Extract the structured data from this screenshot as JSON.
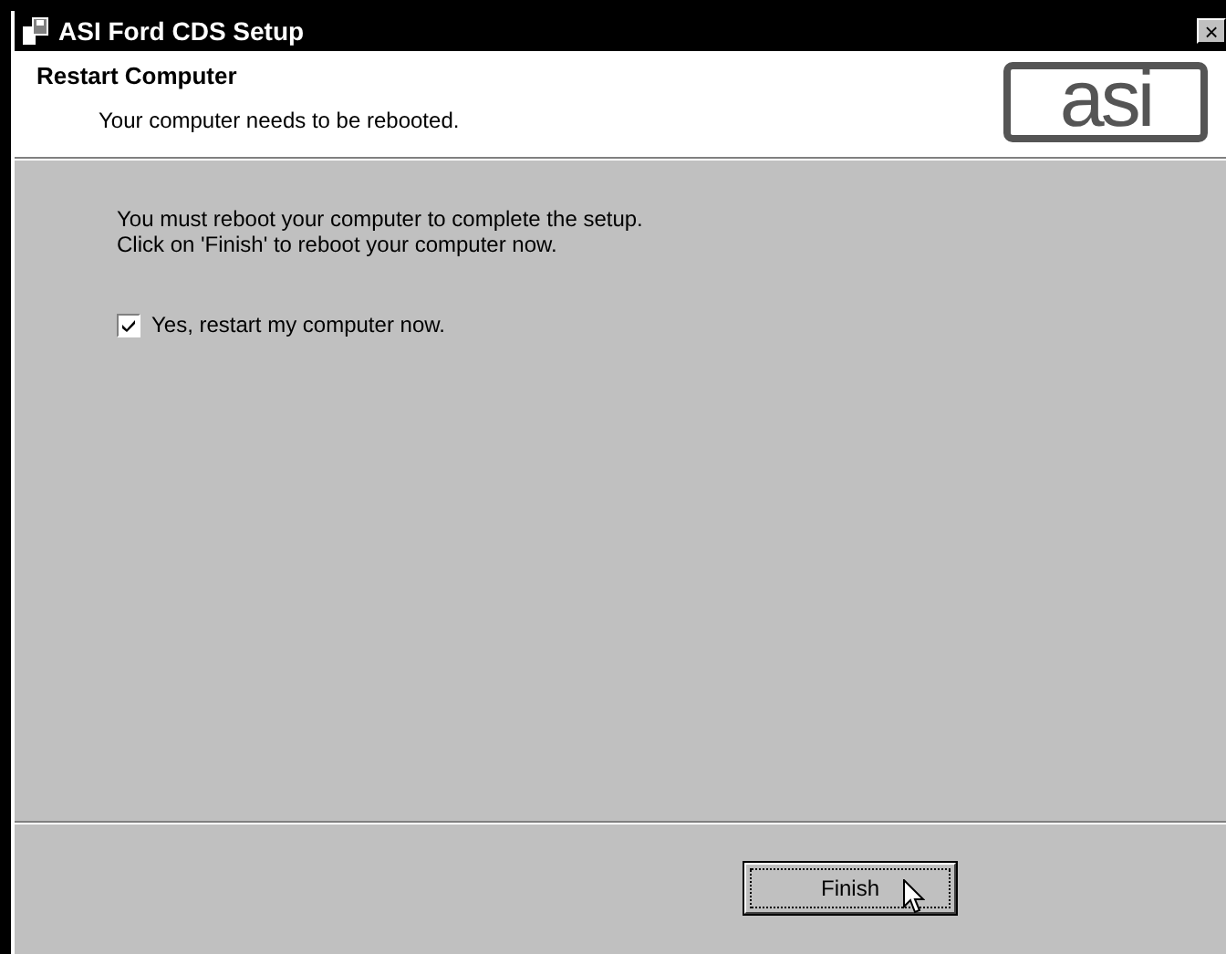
{
  "window": {
    "title": "ASI Ford CDS Setup",
    "close": "×"
  },
  "header": {
    "title": "Restart Computer",
    "subtitle": "Your computer needs to be rebooted.",
    "logo": "asi"
  },
  "body": {
    "message": [
      "You must reboot your computer to complete the setup.",
      "Click on 'Finish' to reboot your computer now."
    ],
    "checkbox": {
      "label": "Yes, restart my computer now.",
      "checked": true
    }
  },
  "buttons": [
    {
      "label": "Finish",
      "focused": true
    }
  ]
}
